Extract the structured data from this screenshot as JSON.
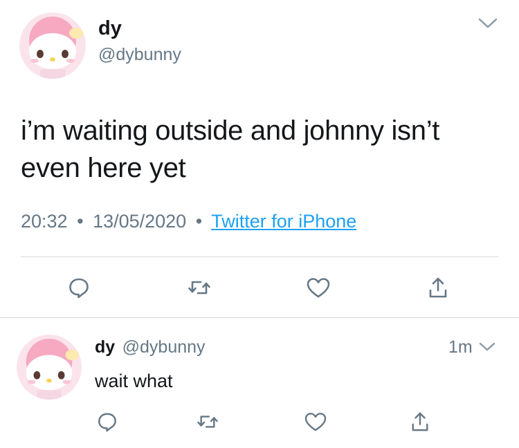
{
  "main_tweet": {
    "author_name": "dy",
    "author_handle": "@dybunny",
    "text": "i’m waiting outside and johnny isn’t even here yet",
    "time": "20:32",
    "separator": "•",
    "date": "13/05/2020",
    "source": "Twitter for iPhone"
  },
  "reply_tweet": {
    "author_name": "dy",
    "author_handle": "@dybunny",
    "elapsed": "1m",
    "text": "wait what"
  },
  "icons": {
    "reply": "reply-icon",
    "retweet": "retweet-icon",
    "like": "heart-icon",
    "share": "share-icon",
    "menu": "chevron-down-icon",
    "avatar": "avatar-pink-bunny"
  },
  "colors": {
    "text": "#14171a",
    "secondary": "#657786",
    "link": "#1da1f2",
    "icon": "#657786",
    "divider": "#d7d7d7",
    "avatar_pink": "#f7b6c8"
  }
}
